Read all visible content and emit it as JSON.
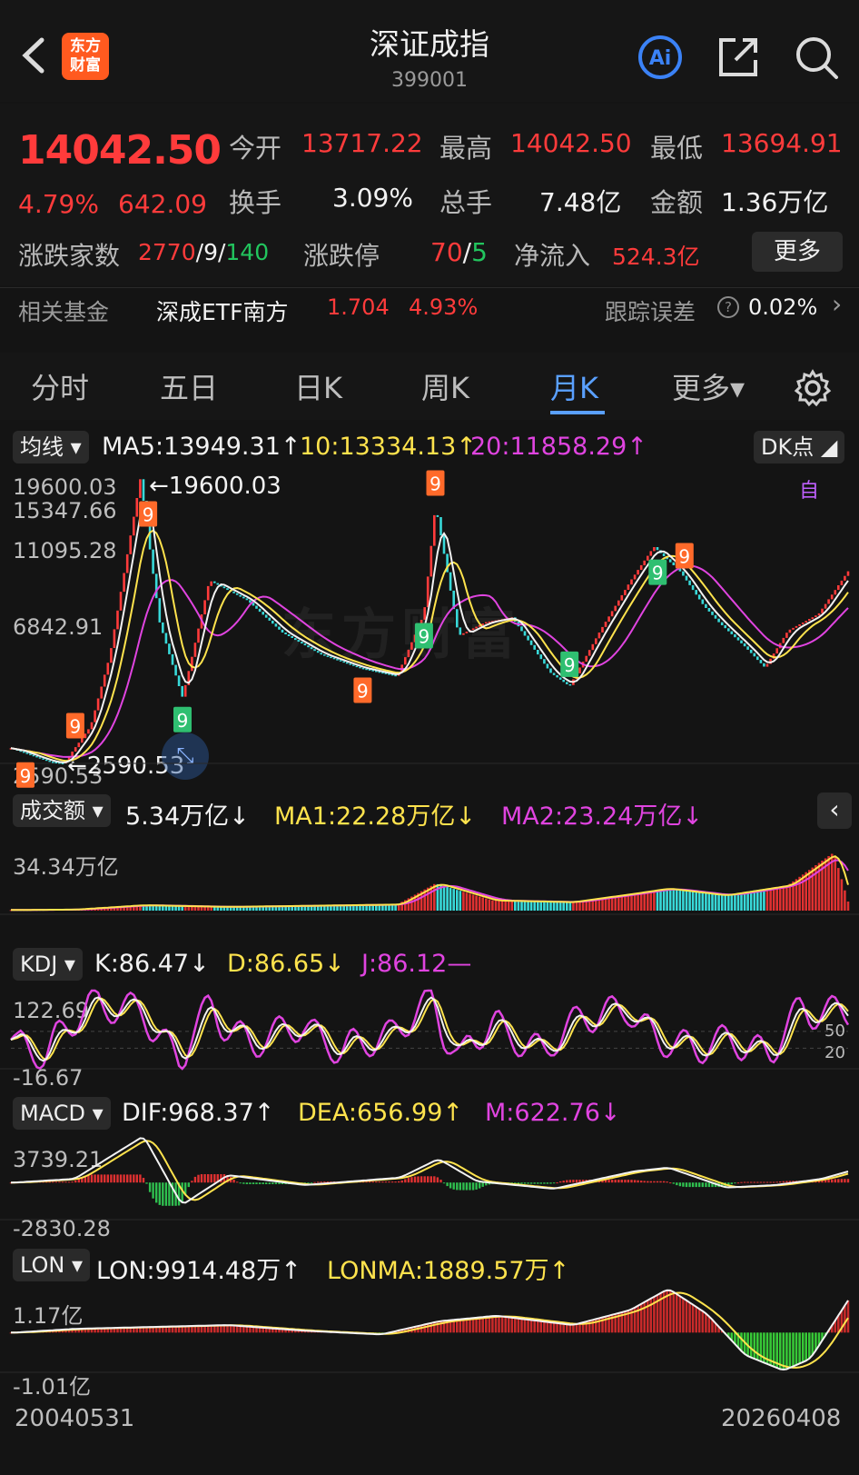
{
  "header": {
    "back_icon": "chevron-left-icon",
    "logo_line1": "东方",
    "logo_line2": "财富",
    "title": "深证成指",
    "code": "399001",
    "ai_label": "Ai",
    "share_icon": "share-icon",
    "search_icon": "search-icon"
  },
  "quote": {
    "price": "14042.50",
    "change_pct": "4.79%",
    "change_abs": "642.09",
    "open_label": "今开",
    "open": "13717.22",
    "high_label": "最高",
    "high": "14042.50",
    "low_label": "最低",
    "low": "13694.91",
    "turnover_label": "换手",
    "turnover": "3.09%",
    "volume_label": "总手",
    "volume": "7.48亿",
    "amount_label": "金额",
    "amount": "1.36万亿",
    "breadth_label": "涨跌家数",
    "breadth_up": "2770",
    "breadth_sep1": "/",
    "breadth_flat": "9",
    "breadth_sep2": "/",
    "breadth_down": "140",
    "limit_label": "涨跌停",
    "limit_up": "70",
    "limit_sep": "/",
    "limit_down": "5",
    "inflow_label": "净流入",
    "inflow": "524.3亿",
    "more_label": "更多"
  },
  "fund": {
    "label": "相关基金",
    "name": "深成ETF南方",
    "price": "1.704",
    "pct": "4.93%",
    "tracking_label": "跟踪误差",
    "tracking_value": "0.02%",
    "chevron": "›"
  },
  "tabs": [
    {
      "label": "分时"
    },
    {
      "label": "五日"
    },
    {
      "label": "日K"
    },
    {
      "label": "周K"
    },
    {
      "label": "月K"
    },
    {
      "label": "更多▾"
    }
  ],
  "chart_data": [
    {
      "type": "line",
      "title": "",
      "indicator_selector": "均线",
      "legend": [
        {
          "name": "MA5",
          "text": "MA5:13949.31↑",
          "color": "#f2f2f2"
        },
        {
          "name": "10",
          "text": "10:13334.13↑",
          "color": "#ffe34d"
        },
        {
          "name": "20",
          "text": "20:11858.29↑",
          "color": "#e044e0"
        }
      ],
      "dk_label": "DK点",
      "y_tick_labels": [
        "19600.03",
        "15347.66",
        "11095.28",
        "6842.91",
        "2590.53"
      ],
      "ylim": [
        2590.53,
        19600.03
      ],
      "max_annotation": "←19600.03",
      "min_annotation": "←2590.53",
      "watermark": "东方财富",
      "self_label": "自",
      "x": [
        2004.42,
        2005.42,
        2005.8,
        2006.5,
        2007.0,
        2007.8,
        2008.3,
        2008.9,
        2009.6,
        2010.6,
        2011.5,
        2012.5,
        2013.5,
        2014.5,
        2015.2,
        2015.5,
        2016.1,
        2016.8,
        2017.5,
        2018.5,
        2019.0,
        2019.8,
        2020.6,
        2021.2,
        2021.9,
        2022.5,
        2022.9,
        2023.6,
        2024.1,
        2024.7,
        2025.5,
        2026.27
      ],
      "values": [
        3500,
        2700,
        2590.53,
        4800,
        9000,
        19600.03,
        11000,
        6500,
        13500,
        12300,
        10400,
        9100,
        8300,
        7800,
        11500,
        18000,
        10200,
        11000,
        11300,
        8000,
        7200,
        10500,
        13500,
        15500,
        14000,
        12000,
        11000,
        9500,
        8300,
        10500,
        11500,
        14042.5
      ],
      "countdown_markers": [
        "9",
        "9",
        "9",
        "9",
        "9",
        "9",
        "9",
        "9",
        "9",
        "9"
      ]
    },
    {
      "type": "bar",
      "title": "",
      "indicator_selector": "成交额",
      "legend": [
        {
          "name": "",
          "text": "5.34万亿↓",
          "color": "#f2f2f2"
        },
        {
          "name": "MA1",
          "text": "MA1:22.28万亿↓",
          "color": "#ffe34d"
        },
        {
          "name": "MA2",
          "text": "MA2:23.24万亿↓",
          "color": "#e044e0"
        }
      ],
      "y_tick_labels": [
        "34.34万亿"
      ],
      "ylim": [
        0,
        34.34
      ],
      "x": [
        2004.42,
        2006.0,
        2007.8,
        2010.0,
        2014.5,
        2015.5,
        2017.0,
        2019.0,
        2020.6,
        2021.5,
        2023.0,
        2024.7,
        2025.5,
        2025.9,
        2026.27
      ],
      "values": [
        0.4,
        0.6,
        3.2,
        2.2,
        3.6,
        16.0,
        6.0,
        5.0,
        10.0,
        13.0,
        9.0,
        15.0,
        28.0,
        34.34,
        5.34
      ]
    },
    {
      "type": "line",
      "title": "",
      "indicator_selector": "KDJ",
      "legend": [
        {
          "name": "K",
          "text": "K:86.47↓",
          "color": "#f2f2f2"
        },
        {
          "name": "D",
          "text": "D:86.65↓",
          "color": "#ffe34d"
        },
        {
          "name": "J",
          "text": "J:86.12—",
          "color": "#e044e0"
        }
      ],
      "y_tick_labels": [
        "122.69",
        "-16.67"
      ],
      "ref_lines": [
        "50",
        "20"
      ],
      "ylim": [
        -16.67,
        122.69
      ],
      "x": [
        2004.42,
        2005.3,
        2006.5,
        2007.8,
        2008.8,
        2009.6,
        2010.7,
        2012.0,
        2013.0,
        2014.3,
        2015.4,
        2016.1,
        2017.0,
        2018.3,
        2019.3,
        2020.5,
        2021.3,
        2022.3,
        2023.2,
        2024.2,
        2025.0,
        2026.27
      ],
      "values": [
        35,
        10,
        95,
        90,
        5,
        85,
        30,
        60,
        20,
        40,
        100,
        10,
        60,
        15,
        70,
        90,
        40,
        20,
        35,
        10,
        80,
        86.47
      ]
    },
    {
      "type": "bar",
      "title": "",
      "indicator_selector": "MACD",
      "legend": [
        {
          "name": "DIF",
          "text": "DIF:968.37↑",
          "color": "#f2f2f2"
        },
        {
          "name": "DEA",
          "text": "DEA:656.99↑",
          "color": "#ffe34d"
        },
        {
          "name": "M",
          "text": "M:622.76↓",
          "color": "#e044e0"
        }
      ],
      "y_tick_labels": [
        "3739.21",
        "-2830.28"
      ],
      "ylim": [
        -2830.28,
        3739.21
      ],
      "x": [
        2004.42,
        2006.0,
        2007.8,
        2008.8,
        2010.0,
        2012.0,
        2014.5,
        2015.5,
        2016.5,
        2018.5,
        2020.6,
        2021.5,
        2023.0,
        2024.3,
        2025.5,
        2026.27
      ],
      "values": [
        0,
        300,
        3739.21,
        -1800,
        600,
        -200,
        400,
        1900,
        100,
        -500,
        900,
        1200,
        -400,
        -200,
        300,
        968.37
      ]
    },
    {
      "type": "area",
      "title": "",
      "indicator_selector": "LON",
      "legend": [
        {
          "name": "LON",
          "text": "LON:9914.48万↑",
          "color": "#f2f2f2"
        },
        {
          "name": "LONMA",
          "text": "LONMA:1889.57万↑",
          "color": "#ffe34d"
        }
      ],
      "y_tick_labels": [
        "1.17亿",
        "-1.01亿"
      ],
      "ylim": [
        -1.01,
        1.17
      ],
      "x_tick_labels": [
        "20040531",
        "20260408"
      ],
      "x": [
        2004.42,
        2006.0,
        2008.0,
        2010.0,
        2012.0,
        2014.0,
        2015.5,
        2017.0,
        2019.0,
        2020.5,
        2021.5,
        2022.5,
        2023.5,
        2024.5,
        2025.2,
        2026.27
      ],
      "values": [
        0.0,
        0.1,
        0.15,
        0.2,
        0.05,
        -0.05,
        0.3,
        0.45,
        0.2,
        0.6,
        1.17,
        0.5,
        -0.6,
        -1.01,
        -0.7,
        0.99
      ]
    }
  ]
}
